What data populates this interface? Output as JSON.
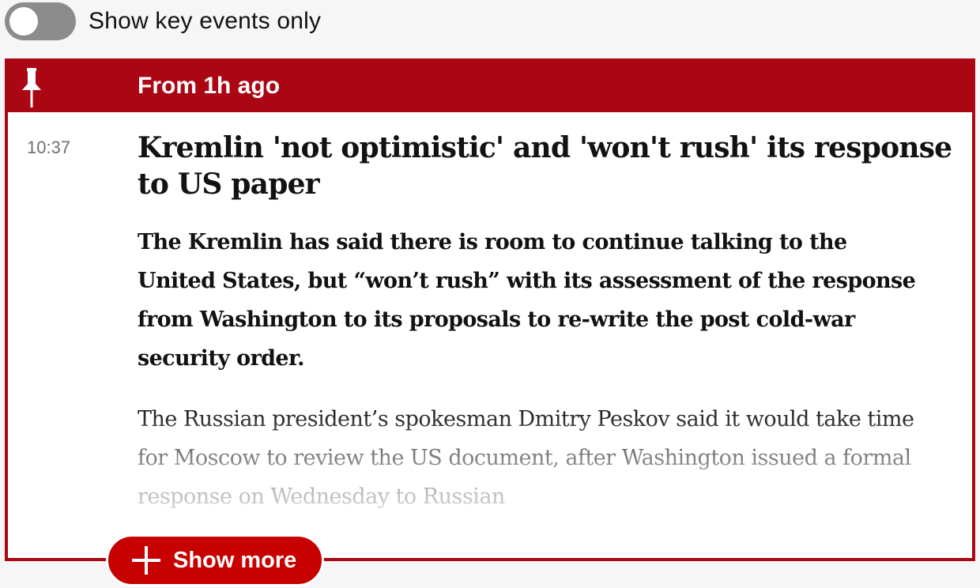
{
  "filter": {
    "toggle_label": "Show key events only",
    "toggle_on": false
  },
  "pinned_post": {
    "header_label": "From 1h ago",
    "timestamp": "10:37",
    "headline": "Kremlin 'not optimistic' and 'won't rush' its response to US paper",
    "standfirst": "The Kremlin has said there is room to continue talking to the United States, but “won’t rush” with its assessment of the response from Washington to its proposals to re-write the post cold-war security order.",
    "body": "The Russian president’s spokesman Dmitry Peskov said it would take time for Moscow to review the US document, after Washington issued a formal response on Wednesday to Russian",
    "show_more_label": "Show more"
  },
  "colors": {
    "accent": "#ab0613",
    "button": "#c70000",
    "toggle_off": "#8c8c8c",
    "background": "#f6f6f6"
  },
  "icons": {
    "pin": "pin-icon",
    "plus": "plus-icon"
  }
}
